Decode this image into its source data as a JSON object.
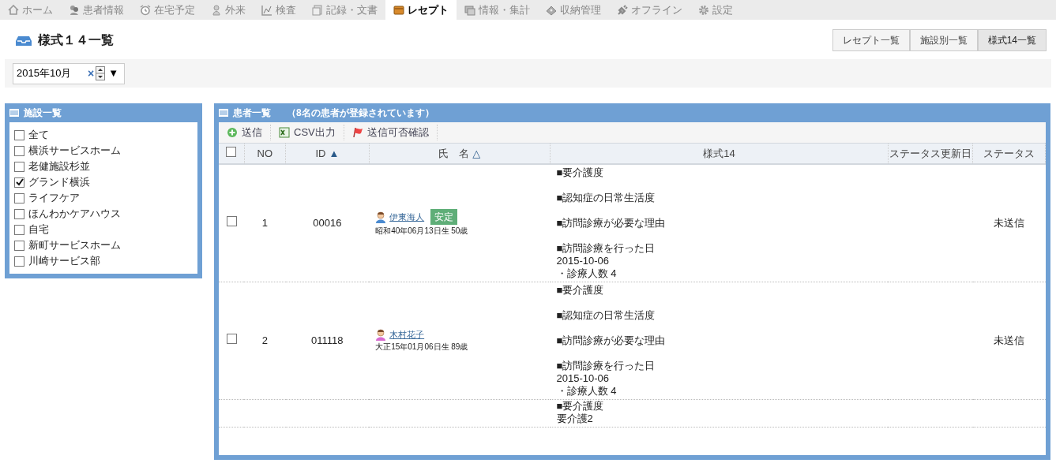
{
  "nav_tabs": [
    {
      "label": "ホーム",
      "selected": false
    },
    {
      "label": "患者情報",
      "selected": false
    },
    {
      "label": "在宅予定",
      "selected": false
    },
    {
      "label": "外来",
      "selected": false
    },
    {
      "label": "検査",
      "selected": false
    },
    {
      "label": "記録・文書",
      "selected": false
    },
    {
      "label": "レセプト",
      "selected": true
    },
    {
      "label": "情報・集計",
      "selected": false
    },
    {
      "label": "収納管理",
      "selected": false
    },
    {
      "label": "オフライン",
      "selected": false
    },
    {
      "label": "設定",
      "selected": false
    }
  ],
  "page_title": "様式１４一覧",
  "view_buttons": [
    {
      "label": "レセプト一覧",
      "selected": false
    },
    {
      "label": "施設別一覧",
      "selected": false
    },
    {
      "label": "様式14一覧",
      "selected": true
    }
  ],
  "month_field": {
    "value": "2015年10月",
    "clear": "×",
    "dropdown": "▼"
  },
  "facility_panel": {
    "title": "施設一覧",
    "items": [
      {
        "label": "全て",
        "checked": false
      },
      {
        "label": "横浜サービスホーム",
        "checked": false
      },
      {
        "label": "老健施設杉並",
        "checked": false
      },
      {
        "label": "グランド横浜",
        "checked": true
      },
      {
        "label": "ライフケア",
        "checked": false
      },
      {
        "label": "ほんわかケアハウス",
        "checked": false
      },
      {
        "label": "自宅",
        "checked": false
      },
      {
        "label": "新町サービスホーム",
        "checked": false
      },
      {
        "label": "川崎サービス部",
        "checked": false
      }
    ]
  },
  "patient_panel": {
    "title": "患者一覧",
    "count_note": "（8名の患者が登録されています）",
    "toolbar": [
      "送信",
      "CSV出力",
      "送信可否確認"
    ],
    "table": {
      "select_all_checked": false,
      "columns": [
        {
          "label": "NO"
        },
        {
          "label": "ID",
          "sort_mark": "▲"
        },
        {
          "label": "氏　名",
          "sort_mark": "△"
        },
        {
          "label": "様式14"
        },
        {
          "label": "ステータス更新日"
        },
        {
          "label": "ステータス"
        }
      ],
      "rows": [
        {
          "checked": false,
          "no": "1",
          "id": "00016",
          "patient": {
            "name": "伊東海人",
            "kind": "male",
            "badge": "安定",
            "birth": "昭和40年06月13日生 50歳"
          },
          "form14": [
            {
              "heading": "■要介護度"
            },
            {
              "heading": "■認知症の日常生活度"
            },
            {
              "heading": "■訪問診療が必要な理由"
            },
            {
              "heading": "■訪問診療を行った日",
              "values": [
                "2015-10-06",
                "・診療人数 4"
              ]
            }
          ],
          "status": "未送信"
        },
        {
          "checked": false,
          "no": "2",
          "id": "011118",
          "patient": {
            "name": "木村花子",
            "kind": "female",
            "birth": "大正15年01月06日生 89歳"
          },
          "form14": [
            {
              "heading": "■要介護度"
            },
            {
              "heading": "■認知症の日常生活度"
            },
            {
              "heading": "■訪問診療が必要な理由"
            },
            {
              "heading": "■訪問診療を行った日",
              "values": [
                "2015-10-06",
                "・診療人数 4"
              ]
            }
          ],
          "status": "未送信"
        },
        {
          "form14": [
            {
              "heading": "■要介護度",
              "values": [
                "要介護2"
              ]
            }
          ]
        }
      ]
    }
  }
}
